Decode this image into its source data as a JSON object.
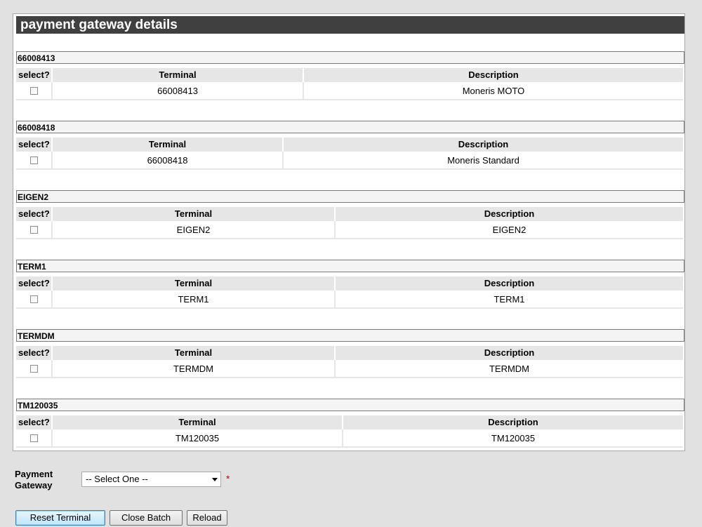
{
  "panel": {
    "title": "payment gateway details"
  },
  "columns": {
    "select": "select?",
    "terminal": "Terminal",
    "description": "Description"
  },
  "groups": [
    {
      "name": "66008413",
      "terminal": "66008413",
      "description": "Moneris MOTO",
      "checked": false
    },
    {
      "name": "66008418",
      "terminal": "66008418",
      "description": "Moneris Standard",
      "checked": false
    },
    {
      "name": "EIGEN2",
      "terminal": "EIGEN2",
      "description": "EIGEN2",
      "checked": false
    },
    {
      "name": "TERM1",
      "terminal": "TERM1",
      "description": "TERM1",
      "checked": false
    },
    {
      "name": "TERMDM",
      "terminal": "TERMDM",
      "description": "TERMDM",
      "checked": false
    },
    {
      "name": "TM120035",
      "terminal": "TM120035",
      "description": "TM120035",
      "checked": false
    }
  ],
  "form": {
    "gateway_label_line1": "Payment",
    "gateway_label_line2": "Gateway",
    "gateway_select_value": "-- Select One --",
    "required_marker": "*"
  },
  "buttons": {
    "reset": "Reset Terminal",
    "close_batch": "Close Batch",
    "reload": "Reload"
  }
}
